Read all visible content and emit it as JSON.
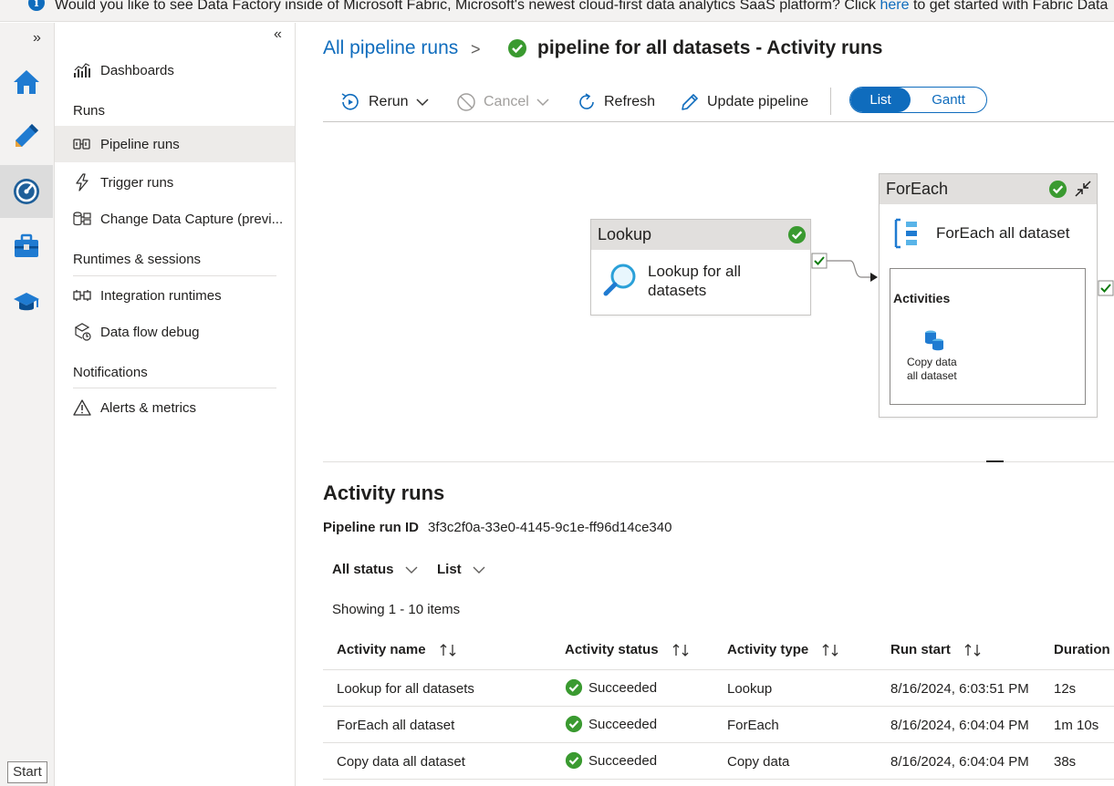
{
  "banner": {
    "text": "Would you like to see Data Factory inside of Microsoft Fabric, Microsoft's newest cloud-first data analytics SaaS platform? Click",
    "link": "here",
    "text_after": "to get started with Fabric Data"
  },
  "rail": {
    "items": [
      {
        "icon": "home-icon"
      },
      {
        "icon": "pencil-icon"
      },
      {
        "icon": "monitor-icon",
        "active": true
      },
      {
        "icon": "toolbox-icon"
      },
      {
        "icon": "graduation-cap-icon"
      }
    ],
    "start_label": "Start"
  },
  "menu": {
    "dashboards": "Dashboards",
    "runs_section": "Runs",
    "pipeline_runs": "Pipeline runs",
    "trigger_runs": "Trigger runs",
    "cdc": "Change Data Capture (previ...",
    "runtimes_section": "Runtimes & sessions",
    "integration_runtimes": "Integration runtimes",
    "data_flow_debug": "Data flow debug",
    "notifications_section": "Notifications",
    "alerts_metrics": "Alerts & metrics"
  },
  "header": {
    "breadcrumb": "All pipeline runs",
    "separator": ">",
    "title": "pipeline for all datasets - Activity runs"
  },
  "toolbar": {
    "rerun": "Rerun",
    "cancel": "Cancel",
    "refresh": "Refresh",
    "update_pipeline": "Update pipeline",
    "view_list": "List",
    "view_gantt": "Gantt"
  },
  "canvas": {
    "lookup": {
      "header": "Lookup",
      "label_line1": "Lookup for all",
      "label_line2": "datasets"
    },
    "foreach": {
      "header": "ForEach",
      "label": "ForEach all dataset",
      "activities_label": "Activities",
      "child_line1": "Copy data",
      "child_line2": "all dataset"
    }
  },
  "activity_runs": {
    "title": "Activity runs",
    "pipeline_run_id_label": "Pipeline run ID",
    "pipeline_run_id": "3f3c2f0a-33e0-4145-9c1e-ff96d14ce340",
    "filter_status": "All status",
    "filter_view": "List",
    "showing": "Showing 1 - 10 items",
    "columns": [
      "Activity name",
      "Activity status",
      "Activity type",
      "Run start",
      "Duration"
    ],
    "rows": [
      {
        "name": "Lookup for all datasets",
        "status": "Succeeded",
        "type": "Lookup",
        "run_start": "8/16/2024, 6:03:51 PM",
        "duration": "12s"
      },
      {
        "name": "ForEach all dataset",
        "status": "Succeeded",
        "type": "ForEach",
        "run_start": "8/16/2024, 6:04:04 PM",
        "duration": "1m 10s"
      },
      {
        "name": "Copy data all dataset",
        "status": "Succeeded",
        "type": "Copy data",
        "run_start": "8/16/2024, 6:04:04 PM",
        "duration": "38s"
      }
    ]
  },
  "colors": {
    "accent": "#0f6cbd",
    "success": "#107c10"
  }
}
